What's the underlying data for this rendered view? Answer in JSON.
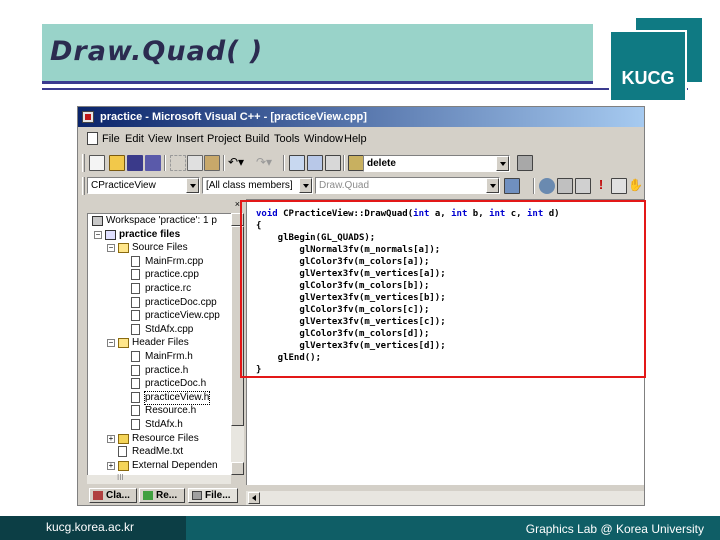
{
  "slide": {
    "title": "Draw.Quad( )",
    "logo": "KUCG",
    "footer_left": "kucg.korea.ac.kr",
    "footer_right": "Graphics Lab @ Korea University",
    "colors": {
      "title_bg": "#99d3c9",
      "logo_bg": "#0f7a83",
      "footer_bg": "#0f5e66",
      "highlight": "#e31818"
    }
  },
  "window": {
    "title": "practice - Microsoft Visual C++ - [practiceView.cpp]",
    "menu": [
      "File",
      "Edit",
      "View",
      "Insert",
      "Project",
      "Build",
      "Tools",
      "Window",
      "Help"
    ]
  },
  "toolbar": {
    "find_value": "delete",
    "class_combo": "CPracticeView",
    "filter_combo": "[All class members]",
    "member_combo": "Draw.Quad"
  },
  "workspace": {
    "header_x": "×",
    "tree": [
      {
        "label": "Workspace 'practice': 1 p",
        "indent": 0,
        "icon": "workspace-icon",
        "expander": ""
      },
      {
        "label": "practice files",
        "indent": 1,
        "icon": "project-icon",
        "expander": "−",
        "bold": true
      },
      {
        "label": "Source Files",
        "indent": 2,
        "icon": "folder-open-icon",
        "expander": "−"
      },
      {
        "label": "MainFrm.cpp",
        "indent": 3,
        "icon": "file-icon",
        "expander": ""
      },
      {
        "label": "practice.cpp",
        "indent": 3,
        "icon": "file-icon",
        "expander": ""
      },
      {
        "label": "practice.rc",
        "indent": 3,
        "icon": "file-icon",
        "expander": ""
      },
      {
        "label": "practiceDoc.cpp",
        "indent": 3,
        "icon": "file-icon",
        "expander": ""
      },
      {
        "label": "practiceView.cpp",
        "indent": 3,
        "icon": "file-icon",
        "expander": ""
      },
      {
        "label": "StdAfx.cpp",
        "indent": 3,
        "icon": "file-icon",
        "expander": ""
      },
      {
        "label": "Header Files",
        "indent": 2,
        "icon": "folder-open-icon",
        "expander": "−"
      },
      {
        "label": "MainFrm.h",
        "indent": 3,
        "icon": "file-icon",
        "expander": ""
      },
      {
        "label": "practice.h",
        "indent": 3,
        "icon": "file-icon",
        "expander": ""
      },
      {
        "label": "practiceDoc.h",
        "indent": 3,
        "icon": "file-icon",
        "expander": ""
      },
      {
        "label": "practiceView.h",
        "indent": 3,
        "icon": "file-icon",
        "expander": "",
        "selected": true
      },
      {
        "label": "Resource.h",
        "indent": 3,
        "icon": "file-icon",
        "expander": ""
      },
      {
        "label": "StdAfx.h",
        "indent": 3,
        "icon": "file-icon",
        "expander": ""
      },
      {
        "label": "Resource Files",
        "indent": 2,
        "icon": "folder-icon",
        "expander": "+"
      },
      {
        "label": "ReadMe.txt",
        "indent": 2,
        "icon": "file-icon",
        "expander": ""
      },
      {
        "label": "External Dependen",
        "indent": 2,
        "icon": "folder-icon",
        "expander": "+"
      }
    ],
    "hscroll_mark": "III",
    "tabs": [
      "Cla...",
      "Re...",
      "File..."
    ]
  },
  "code": [
    [
      "void CPracticeView::DrawQuad(int a, int b, int c, int d)",
      "sig"
    ],
    [
      "{",
      ""
    ],
    [
      "    glBegin(GL_QUADS);",
      ""
    ],
    [
      "        glNormal3fv(m_normals[a]);",
      ""
    ],
    [
      "        glColor3fv(m_colors[a]);",
      ""
    ],
    [
      "        glVertex3fv(m_vertices[a]);",
      ""
    ],
    [
      "        glColor3fv(m_colors[b]);",
      ""
    ],
    [
      "        glVertex3fv(m_vertices[b]);",
      ""
    ],
    [
      "        glColor3fv(m_colors[c]);",
      ""
    ],
    [
      "        glVertex3fv(m_vertices[c]);",
      ""
    ],
    [
      "        glColor3fv(m_colors[d]);",
      ""
    ],
    [
      "        glVertex3fv(m_vertices[d]);",
      ""
    ],
    [
      "    glEnd();",
      ""
    ],
    [
      "}",
      ""
    ]
  ]
}
